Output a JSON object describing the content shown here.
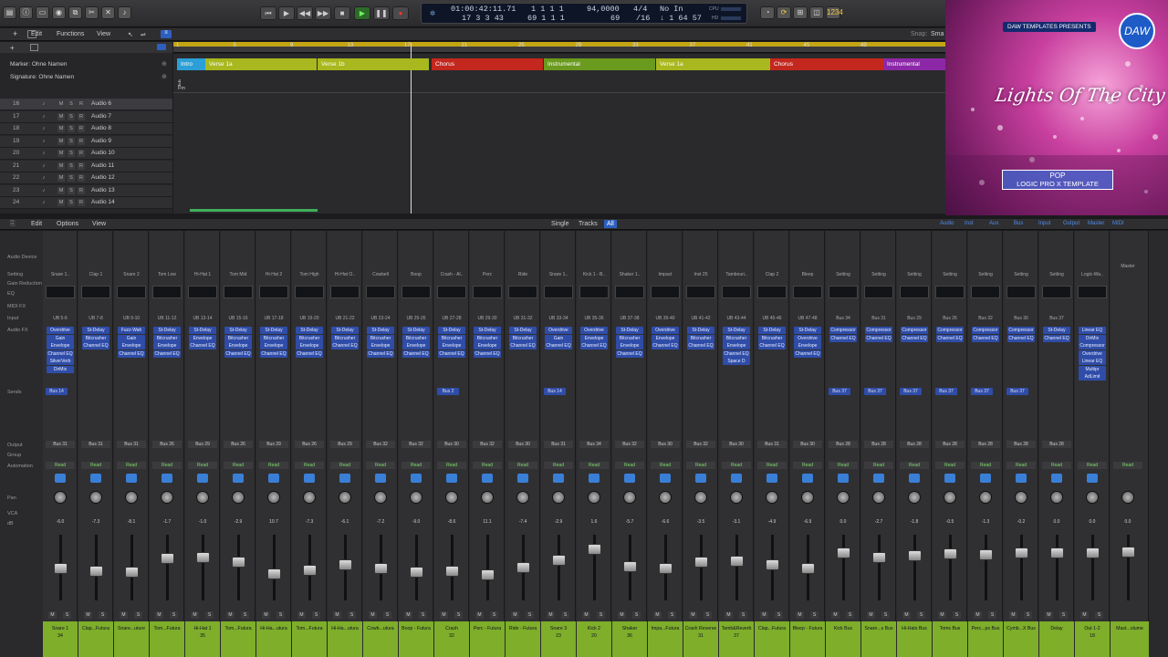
{
  "transport": {
    "position_top": "01:00:42:11.71",
    "position_bottom": "17 3 3 43",
    "beats_top": "1 1 1 1",
    "beats_bottom": "69 1 1 1",
    "tempo": "94,0000",
    "sig_top": "4/4",
    "sig_bottom": "/16",
    "num_top": "",
    "num_bottom": "69",
    "key_top": "No In",
    "key_bottom": "↓ 1 64 57",
    "cpu": "CPU",
    "hd": "HD"
  },
  "tracks_menu": {
    "edit": "Edit",
    "functions": "Functions",
    "view": "View",
    "snap": "Snap:",
    "snap_val": "Sma"
  },
  "globals": {
    "marker": "Marker: Ohne Namen",
    "signature": "Signature: Ohne Namen",
    "sig_val": "4",
    "sig_val2": "4",
    "key": "Fm"
  },
  "ruler": [
    "1",
    "5",
    "9",
    "13",
    "17",
    "21",
    "25",
    "29",
    "33",
    "37",
    "41",
    "45",
    "49"
  ],
  "markers": [
    {
      "label": "Intro",
      "color": "#2b9fd6"
    },
    {
      "label": "Verse 1a",
      "color": "#a8b81e"
    },
    {
      "label": "Verse 1b",
      "color": "#a8b81e"
    },
    {
      "label": "Chorus",
      "color": "#c3271d"
    },
    {
      "label": "Instrumental",
      "color": "#6a9a1e"
    },
    {
      "label": "Verse 1a",
      "color": "#a8b81e"
    },
    {
      "label": "Chorus",
      "color": "#c3271d"
    },
    {
      "label": "Instrumental",
      "color": "#8c28a8"
    }
  ],
  "track_rows": [
    {
      "num": "16",
      "name": "Audio 6"
    },
    {
      "num": "17",
      "name": "Audio 7"
    },
    {
      "num": "18",
      "name": "Audio 8"
    },
    {
      "num": "19",
      "name": "Audio 9"
    },
    {
      "num": "20",
      "name": "Audio 10"
    },
    {
      "num": "21",
      "name": "Audio 11"
    },
    {
      "num": "22",
      "name": "Audio 12"
    },
    {
      "num": "23",
      "name": "Audio 13"
    },
    {
      "num": "24",
      "name": "Audio 14"
    }
  ],
  "art": {
    "badge": "DAW TEMPLATES PRESENTS",
    "logo": "DAW",
    "title": "Lights Of The City",
    "genre": "POP",
    "product": "LOGIC PRO X TEMPLATE"
  },
  "mixer_menu": {
    "edit": "Edit",
    "options": "Options",
    "view": "View",
    "single": "Single",
    "tracks": "Tracks",
    "all": "All",
    "filters": [
      "Audio",
      "Inst",
      "Aux",
      "Bus",
      "Input",
      "Output",
      "Master",
      "MIDI"
    ]
  },
  "row_labels": [
    "Audio Device",
    "Setting",
    "Gain Reduction",
    "EQ",
    "MIDI FX",
    "Input",
    "Audio FX",
    "Sends",
    "Output",
    "Group",
    "Automation",
    "Pan",
    "VCA",
    "dB"
  ],
  "strips": [
    {
      "setting": "Snare 1..",
      "input": "UB 5-6",
      "fx": [
        "Overdrive",
        "Gain",
        "Envelope",
        "Channel EQ",
        "SilverVerb",
        "DirMix"
      ],
      "send": "Bus 14",
      "out": "Bus 31",
      "db": "-6.0",
      "name": "Snare 1",
      "num": "34",
      "cap": 0.45
    },
    {
      "setting": "Clap 1",
      "input": "UB 7-8",
      "fx": [
        "St-Delay",
        "Bitcrusher",
        "Channel EQ"
      ],
      "send": "",
      "out": "Bus 31",
      "db": "-7.3",
      "name": "Clap...Futura",
      "num": "",
      "cap": 0.5
    },
    {
      "setting": "Snare 2",
      "input": "UB 9-10",
      "fx": [
        "Fuzz-Wah",
        "Gain",
        "Envelope",
        "Channel EQ"
      ],
      "send": "",
      "out": "Bus 31",
      "db": "-8.1",
      "name": "Snare...uture",
      "num": "",
      "cap": 0.52
    },
    {
      "setting": "Tom Low",
      "input": "UB 11-12",
      "fx": [
        "St-Delay",
        "Bitcrusher",
        "Envelope",
        "Channel EQ"
      ],
      "send": "",
      "out": "Bus 26",
      "db": "-1.7",
      "name": "Tom...Futura",
      "num": "",
      "cap": 0.3
    },
    {
      "setting": "Hi-Hat 1",
      "input": "UB 13-14",
      "fx": [
        "St-Delay",
        "Envelope",
        "Channel EQ"
      ],
      "send": "",
      "out": "Bus 29",
      "db": "-1.0",
      "name": "Hi-Hat 1",
      "num": "35",
      "cap": 0.28
    },
    {
      "setting": "Tom Mid",
      "input": "UB 15-16",
      "fx": [
        "St-Delay",
        "Bitcrusher",
        "Envelope",
        "Channel EQ"
      ],
      "send": "",
      "out": "Bus 26",
      "db": "-2.9",
      "name": "Tom...Futura",
      "num": "",
      "cap": 0.35
    },
    {
      "setting": "Hi-Hat 2",
      "input": "UB 17-18",
      "fx": [
        "St-Delay",
        "Bitcrusher",
        "Envelope",
        "Channel EQ"
      ],
      "send": "",
      "out": "Bus 29",
      "db": "10.7",
      "name": "Hi-Ha...utura",
      "num": "",
      "cap": 0.55
    },
    {
      "setting": "Tom High",
      "input": "UB 19-20",
      "fx": [
        "St-Delay",
        "Bitcrusher",
        "Envelope",
        "Channel EQ"
      ],
      "send": "",
      "out": "Bus 26",
      "db": "-7.3",
      "name": "Tom...Futura",
      "num": "",
      "cap": 0.48
    },
    {
      "setting": "Hi-Hat O..",
      "input": "UB 21-22",
      "fx": [
        "St-Delay",
        "Bitcrusher",
        "Channel EQ"
      ],
      "send": "",
      "out": "Bus 29",
      "db": "-6.1",
      "name": "Hi-Ha...utura",
      "num": "",
      "cap": 0.4
    },
    {
      "setting": "Cowbell",
      "input": "UB 23-24",
      "fx": [
        "St-Delay",
        "Bitcrusher",
        "Envelope",
        "Channel EQ"
      ],
      "send": "",
      "out": "Bus 32",
      "db": "-7.2",
      "name": "Cowb...utura",
      "num": "",
      "cap": 0.46
    },
    {
      "setting": "Boop",
      "input": "UB 25-26",
      "fx": [
        "St-Delay",
        "Bitcrusher",
        "Envelope",
        "Channel EQ"
      ],
      "send": "",
      "out": "Bus 32",
      "db": "-9.0",
      "name": "Boop - Futura",
      "num": "",
      "cap": 0.52
    },
    {
      "setting": "Crash - Al..",
      "input": "UB 27-28",
      "fx": [
        "St-Delay",
        "Bitcrusher",
        "Envelope",
        "Channel EQ"
      ],
      "send": "Bus 2",
      "out": "Bus 30",
      "db": "-8.6",
      "name": "Crash",
      "num": "32",
      "cap": 0.5
    },
    {
      "setting": "Perc",
      "input": "UB 29-30",
      "fx": [
        "St-Delay",
        "Bitcrusher",
        "Envelope",
        "Channel EQ"
      ],
      "send": "",
      "out": "Bus 32",
      "db": "11.1",
      "name": "Perc - Futura",
      "num": "",
      "cap": 0.56
    },
    {
      "setting": "Ride",
      "input": "UB 31-32",
      "fx": [
        "St-Delay",
        "Bitcrusher",
        "Channel EQ"
      ],
      "send": "",
      "out": "Bus 30",
      "db": "-7.4",
      "name": "Ride - Futura",
      "num": "",
      "cap": 0.44
    },
    {
      "setting": "Snare 1..",
      "input": "UB 33-34",
      "fx": [
        "Overdrive",
        "Gain",
        "Channel EQ"
      ],
      "send": "Bus 14",
      "out": "Bus 31",
      "db": "-2.9",
      "name": "Snare 3",
      "num": "23",
      "cap": 0.33
    },
    {
      "setting": "Kick 1 - B..",
      "input": "UB 35-36",
      "fx": [
        "Overdrive",
        "Envelope",
        "Channel EQ"
      ],
      "send": "",
      "out": "Bus 34",
      "db": "1.6",
      "name": "Kick 2",
      "num": "20",
      "cap": 0.15
    },
    {
      "setting": "Shaker 1..",
      "input": "UB 37-38",
      "fx": [
        "St-Delay",
        "Bitcrusher",
        "Envelope",
        "Channel EQ"
      ],
      "send": "",
      "out": "Bus 32",
      "db": "-5.7",
      "name": "Shaker",
      "num": "36",
      "cap": 0.42
    },
    {
      "setting": "Impact",
      "input": "UB 39-40",
      "fx": [
        "Overdrive",
        "Envelope",
        "Channel EQ"
      ],
      "send": "",
      "out": "Bus 30",
      "db": "-6.6",
      "name": "Impa...Futura",
      "num": "",
      "cap": 0.45
    },
    {
      "setting": "Inst 25",
      "input": "UB 41-42",
      "fx": [
        "St-Delay",
        "Bitcrusher",
        "Channel EQ"
      ],
      "send": "",
      "out": "Bus 32",
      "db": "-3.5",
      "name": "Crash Reverse",
      "num": "31",
      "cap": 0.35
    },
    {
      "setting": "Tambouri..",
      "input": "UB 43-44",
      "fx": [
        "St-Delay",
        "Bitcrusher",
        "Envelope",
        "Channel EQ",
        "Space D"
      ],
      "send": "",
      "out": "Bus 30",
      "db": "-3.1",
      "name": "Tamb&Reverb",
      "num": "37",
      "cap": 0.34
    },
    {
      "setting": "Clap 2",
      "input": "UB 45-46",
      "fx": [
        "St-Delay",
        "Bitcrusher",
        "Channel EQ"
      ],
      "send": "",
      "out": "Bus 31",
      "db": "-4.9",
      "name": "Clap...Futura",
      "num": "",
      "cap": 0.4
    },
    {
      "setting": "Bleep",
      "input": "UB 47-48",
      "fx": [
        "St-Delay",
        "Overdrive",
        "Envelope",
        "Channel EQ"
      ],
      "send": "",
      "out": "Bus 30",
      "db": "-6.9",
      "name": "Bleep - Futura",
      "num": "",
      "cap": 0.45
    },
    {
      "setting": "Setting",
      "input": "Bus 34",
      "fx": [
        "Compressor",
        "Channel EQ"
      ],
      "send": "Bus 37",
      "out": "Bus 28",
      "db": "0.0",
      "name": "Kick Bus",
      "num": "",
      "cap": 0.2
    },
    {
      "setting": "Setting",
      "input": "Bus 31",
      "fx": [
        "Compressor",
        "Channel EQ"
      ],
      "send": "Bus 37",
      "out": "Bus 28",
      "db": "-2.7",
      "name": "Snare...s Bus",
      "num": "",
      "cap": 0.28
    },
    {
      "setting": "Setting",
      "input": "Bus 29",
      "fx": [
        "Compressor",
        "Channel EQ"
      ],
      "send": "Bus 37",
      "out": "Bus 28",
      "db": "-1.8",
      "name": "Hi-Hats Bus",
      "num": "",
      "cap": 0.25
    },
    {
      "setting": "Setting",
      "input": "Bus 26",
      "fx": [
        "Compressor",
        "Channel EQ"
      ],
      "send": "Bus 37",
      "out": "Bus 28",
      "db": "-0.5",
      "name": "Toms Bus",
      "num": "",
      "cap": 0.22
    },
    {
      "setting": "Setting",
      "input": "Bus 32",
      "fx": [
        "Compressor",
        "Channel EQ"
      ],
      "send": "Bus 37",
      "out": "Bus 28",
      "db": "-1.3",
      "name": "Perc...ps Bus",
      "num": "",
      "cap": 0.24
    },
    {
      "setting": "Setting",
      "input": "Bus 30",
      "fx": [
        "Compressor",
        "Channel EQ"
      ],
      "send": "Bus 37",
      "out": "Bus 28",
      "db": "-0.2",
      "name": "Cymb...X Bus",
      "num": "",
      "cap": 0.2
    },
    {
      "setting": "Setting",
      "input": "Bus 37",
      "fx": [
        "St-Delay",
        "Channel EQ"
      ],
      "send": "",
      "out": "Bus 28",
      "db": "0.0",
      "name": "Delay",
      "num": "",
      "cap": 0.2
    },
    {
      "setting": "Logic-Wa..",
      "input": "",
      "fx": [
        "Linear EQ",
        "DirMix",
        "Compressor",
        "Overdrive",
        "Linear EQ",
        "Multipr",
        "AdLimit"
      ],
      "send": "",
      "out": "",
      "db": "0.0",
      "name": "Out 1-2",
      "num": "18",
      "cap": 0.2
    }
  ],
  "master": {
    "label": "Master",
    "out": "",
    "db": "0.0",
    "name": "Mast...olume"
  }
}
